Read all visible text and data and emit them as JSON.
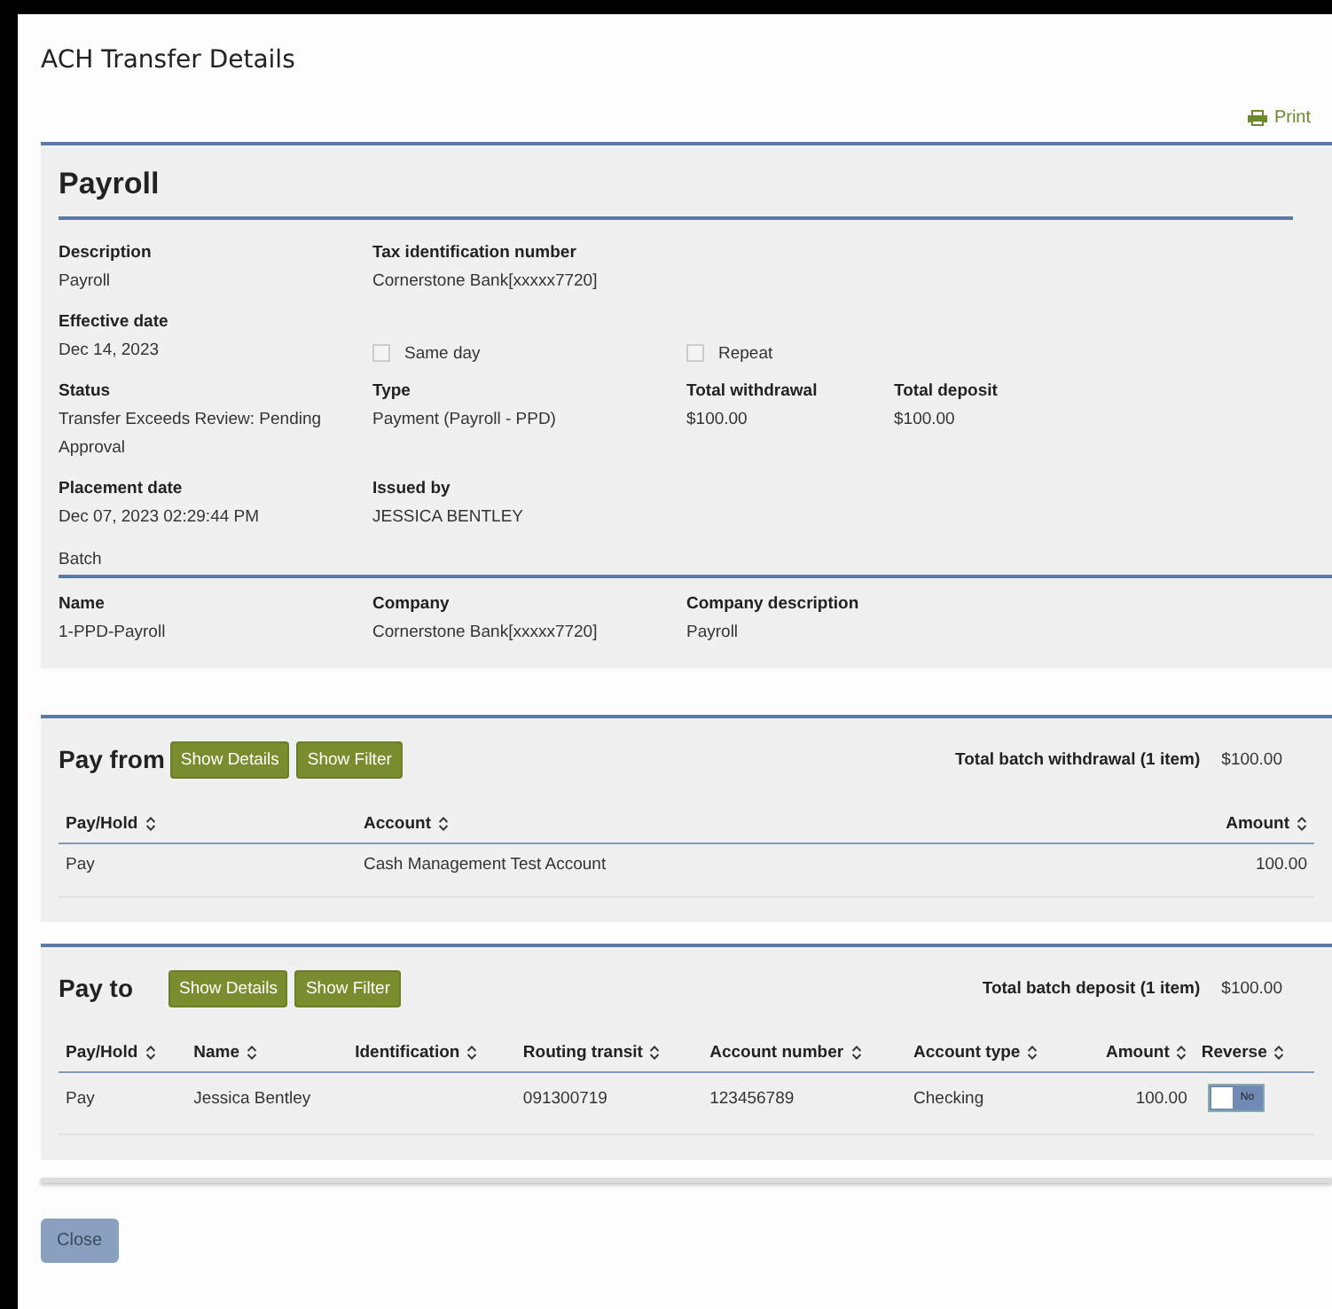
{
  "dialog": {
    "title": "ACH Transfer Details",
    "print_link": "Print"
  },
  "transfer": {
    "title": "Payroll",
    "rows": [
      [
        {
          "kind": "field",
          "label": "Description",
          "value": "Payroll"
        },
        {
          "kind": "field",
          "label": "Tax identification number",
          "value": "Cornerstone Bank[xxxxx7720]"
        }
      ],
      [
        {
          "kind": "field",
          "label": "Effective date",
          "value": "Dec 14, 2023"
        },
        {
          "kind": "checkbox",
          "label": "Same day",
          "checked": false
        },
        {
          "kind": "checkbox",
          "label": "Repeat",
          "checked": false
        }
      ],
      [
        {
          "kind": "field",
          "label": "Status",
          "value": "Transfer Exceeds Review: Pending Approval"
        },
        {
          "kind": "field",
          "label": "Type",
          "value": "Payment (Payroll - PPD)"
        },
        {
          "kind": "field",
          "label": "Total withdrawal",
          "value": "$100.00"
        },
        {
          "kind": "field",
          "label": "Total deposit",
          "value": "$100.00"
        }
      ],
      [
        {
          "kind": "field",
          "label": "Placement date",
          "value": "Dec 07, 2023 02:29:44 PM"
        },
        {
          "kind": "field",
          "label": "Issued by",
          "value": "JESSICA BENTLEY"
        }
      ]
    ],
    "batch": {
      "heading": "Batch",
      "fields": [
        {
          "label": "Name",
          "value": "1-PPD-Payroll"
        },
        {
          "label": "Company",
          "value": "Cornerstone Bank[xxxxx7720]"
        },
        {
          "label": "Company description",
          "value": "Payroll"
        }
      ]
    }
  },
  "sections": [
    {
      "title": "Pay from",
      "buttons": [
        "Show Details",
        "Show Filter"
      ],
      "total_label": "Total batch withdrawal (1 item)",
      "total_value": "$100.00",
      "columns": [
        {
          "label": "Pay/Hold",
          "kind": "text"
        },
        {
          "label": "Account",
          "kind": "text"
        },
        {
          "label": "Amount",
          "kind": "amount"
        }
      ],
      "rows": [
        {
          "cells": [
            "Pay",
            "Cash Management Test Account",
            "100.00"
          ]
        }
      ]
    },
    {
      "title": "Pay to",
      "buttons": [
        "Show Details",
        "Show Filter"
      ],
      "total_label": "Total batch deposit (1 item)",
      "total_value": "$100.00",
      "columns": [
        {
          "label": "Pay/Hold",
          "kind": "text"
        },
        {
          "label": "Name",
          "kind": "text"
        },
        {
          "label": "Identification",
          "kind": "text"
        },
        {
          "label": "Routing transit",
          "kind": "text"
        },
        {
          "label": "Account number",
          "kind": "text"
        },
        {
          "label": "Account type",
          "kind": "text"
        },
        {
          "label": "Amount",
          "kind": "amount"
        },
        {
          "label": "Reverse",
          "kind": "text"
        }
      ],
      "rows": [
        {
          "cells": [
            "Pay",
            "Jessica Bentley",
            "",
            "091300719",
            "123456789",
            "Checking",
            "100.00"
          ],
          "reverse": {
            "label": "No",
            "on": false
          }
        }
      ]
    }
  ],
  "close_button": "Close"
}
